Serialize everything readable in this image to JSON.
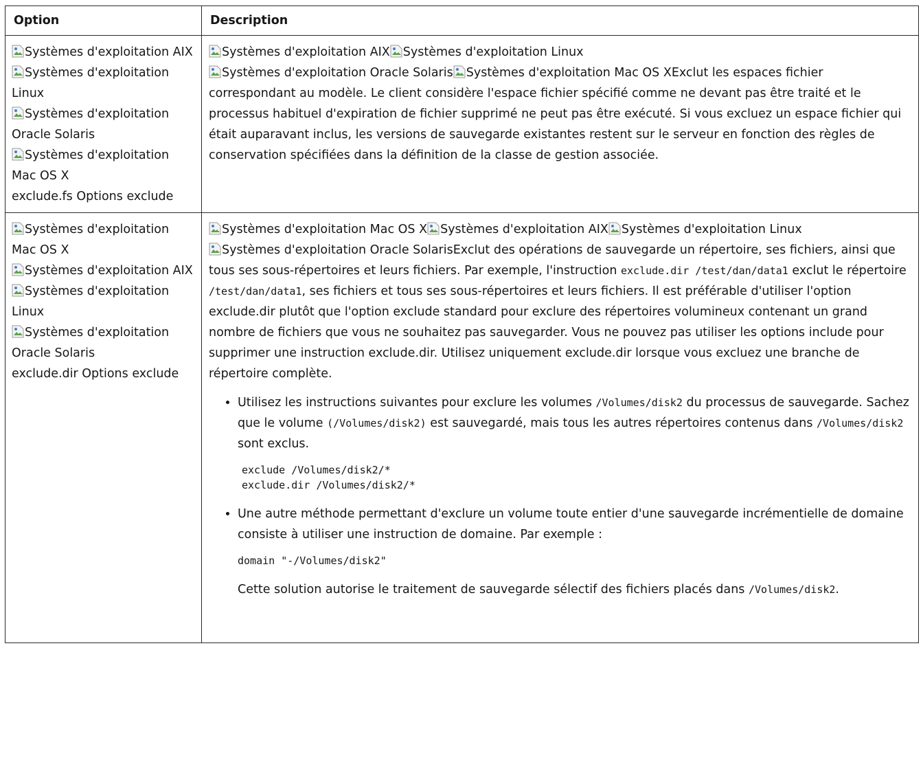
{
  "table": {
    "headers": {
      "option": "Option",
      "description": "Description"
    },
    "row1": {
      "option": {
        "os_aix": "Systèmes d'exploitation AIX",
        "os_linux": "Systèmes d'exploitation Linux",
        "os_solaris": "Systèmes d'exploitation Oracle Solaris",
        "os_mac": "Systèmes d'exploitation Mac OS X",
        "label": "exclude.fs Options exclude"
      },
      "description": {
        "os_aix": "Systèmes d'exploitation AIX",
        "os_linux": "Systèmes d'exploitation Linux",
        "os_solaris": "Systèmes d'exploitation Oracle Solaris",
        "os_mac": "Systèmes d'exploitation Mac OS X",
        "text": "Exclut les espaces fichier correspondant au modèle. Le client considère l'espace fichier spécifié comme ne devant pas être traité et le processus habituel d'expiration de fichier supprimé ne peut pas être exécuté. Si vous excluez un espace fichier qui était auparavant inclus, les versions de sauvegarde existantes restent sur le serveur en fonction des règles de conservation spécifiées dans la définition de la classe de gestion associée."
      }
    },
    "row2": {
      "option": {
        "os_mac": "Systèmes d'exploitation Mac OS X",
        "os_aix": "Systèmes d'exploitation AIX",
        "os_linux": "Systèmes d'exploitation Linux",
        "os_solaris": "Systèmes d'exploitation Oracle Solaris",
        "label": "exclude.dir Options exclude"
      },
      "description": {
        "os_mac": "Systèmes d'exploitation Mac OS X",
        "os_aix": "Systèmes d'exploitation AIX",
        "os_linux": "Systèmes d'exploitation Linux",
        "os_solaris": "Systèmes d'exploitation Oracle Solaris",
        "t1": "Exclut des opérations de sauvegarde un répertoire, ses fichiers, ainsi que tous ses sous-répertoires et leurs fichiers. Par exemple, l'instruction ",
        "c1": "exclude.dir /test/dan/data1",
        "t2": " exclut le répertoire ",
        "c2": "/test/dan/data1",
        "t3": ", ses fichiers et tous ses sous-répertoires et leurs fichiers. Il est préférable d'utiliser l'option exclude.dir plutôt que l'option exclude standard pour exclure des répertoires volumineux contenant un grand nombre de fichiers que vous ne souhaitez pas sauvegarder. Vous ne pouvez pas utiliser les options include pour supprimer une instruction exclude.dir. Utilisez uniquement exclude.dir lorsque vous excluez une branche de répertoire complète.",
        "b1": {
          "t1": "Utilisez les instructions suivantes pour exclure les volumes ",
          "c1": "/Volumes/disk2",
          "t2": " du processus de sauvegarde. Sachez que le volume ",
          "c2": "(/Volumes/disk2)",
          "t3": " est sauvegardé, mais tous les autres répertoires contenus dans ",
          "c3": "/Volumes/disk2",
          "t4": " sont exclus.",
          "code": "exclude /Volumes/disk2/*\nexclude.dir /Volumes/disk2/*"
        },
        "b2": {
          "t1": "Une autre méthode permettant d'exclure un volume toute entier d'une sauvegarde incrémentielle de domaine consiste à utiliser une instruction de domaine. Par exemple :",
          "code": "domain \"-/Volumes/disk2\"",
          "note": "Cette solution autorise le traitement de sauvegarde sélectif des fichiers placés dans ",
          "note_code": "/Volumes/disk2",
          "note_end": "."
        }
      }
    }
  }
}
